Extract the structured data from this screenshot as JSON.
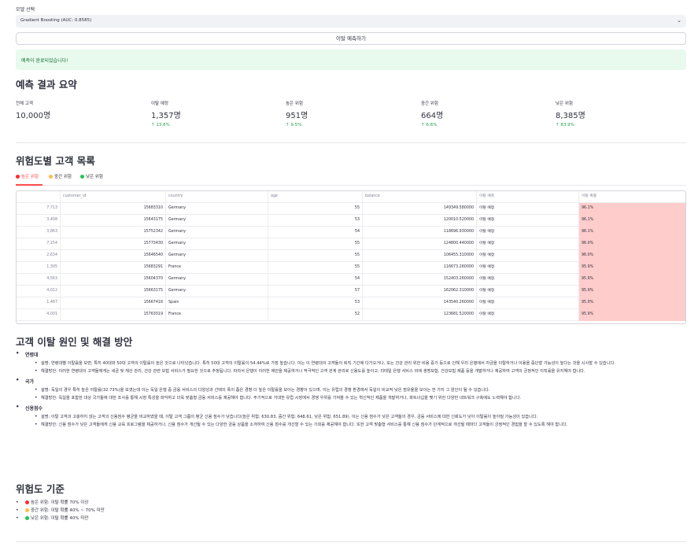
{
  "model_select": {
    "label": "모델 선택",
    "value": "Gradient Boosting (AUC: 0.8585)"
  },
  "predict_button": "이탈 예측하기",
  "success_message": "예측이 완료되었습니다!",
  "summary": {
    "title": "예측 결과 요약",
    "metrics": [
      {
        "label": "전체 고객",
        "value": "10,000명",
        "delta": ""
      },
      {
        "label": "이탈 예정",
        "value": "1,357명",
        "delta": "13.6%"
      },
      {
        "label": "높은 위험",
        "value": "951명",
        "delta": "9.5%"
      },
      {
        "label": "중간 위험",
        "value": "664명",
        "delta": "6.6%"
      },
      {
        "label": "낮은 위험",
        "value": "8,385명",
        "delta": "83.9%"
      }
    ]
  },
  "risk_list": {
    "title": "위험도별 고객 목록",
    "tabs": [
      {
        "label": "높은 위험",
        "color": "#ff2b2b"
      },
      {
        "label": "중간 위험",
        "color": "#ffbd45"
      },
      {
        "label": "낮은 위험",
        "color": "#21c354"
      }
    ],
    "columns": [
      "",
      "customer_id",
      "country",
      "age",
      "balance",
      "이탈 예측",
      "이탈 확률"
    ],
    "rows": [
      [
        "7,713",
        "15683310",
        "Germany",
        "55",
        "149349.580000",
        "이탈 예정",
        "96.1%"
      ],
      [
        "3,408",
        "15643175",
        "Germany",
        "53",
        "120010.520000",
        "이탈 예정",
        "96.1%"
      ],
      [
        "3,863",
        "15752342",
        "Germany",
        "54",
        "118696.930000",
        "이탈 예정",
        "96.1%"
      ],
      [
        "7,154",
        "15773430",
        "Germany",
        "55",
        "124800.440000",
        "이탈 예정",
        "96.0%"
      ],
      [
        "2,634",
        "15646540",
        "Germany",
        "55",
        "106455.310000",
        "이탈 예정",
        "96.0%"
      ],
      [
        "1,305",
        "15683291",
        "France",
        "55",
        "116673.260000",
        "이탈 예정",
        "95.9%"
      ],
      [
        "4,563",
        "15604370",
        "Germany",
        "54",
        "152403.260000",
        "이탈 예정",
        "95.9%"
      ],
      [
        "4,012",
        "15663175",
        "Germany",
        "57",
        "162062.310000",
        "이탈 예정",
        "95.9%"
      ],
      [
        "1,467",
        "15667416",
        "Spain",
        "53",
        "143540.260000",
        "이탈 예정",
        "95.9%"
      ],
      [
        "4,001",
        "15763019",
        "France",
        "52",
        "123681.520000",
        "이탈 예정",
        "95.9%"
      ]
    ]
  },
  "causes": {
    "title": "고객 이탈 원인 및 해결 방안",
    "categories": [
      {
        "name": "연령대",
        "items": [
          "설명: 연령대별 이탈률을 보면, 특히 40대와 50대 고객의 이탈률이 높은 것으로 나타났습니다. 특히 50대 고객의 이탈률이 54.44%로 가장 높습니다. 이는 이 연령대의 고객들이 퇴직 기간에 다가오거나, 또는 건강 관리 위한 비용 증가 등으로 인해 우리 은행에서 자금을 이탈하거나 이용을 중단할 가능성이 높다는 것을 시사할 수 있습니다.",
          "해결방안: 이러한 연령대의 고객들에게는 세금 및 재산 관리, 건강 관련 보험 서비스가 필요한 것으로 추정됩니다. 따라서 은행이 이러한 제안을 제공하거나 적극적인 고객 관계 관리로 신용도를 높이고, 리테일 은행 서비스 외에 생명보험, 건강보험 제품 등을 개발하거나 제공하여 고객의 긍정적인 이직률을 유지해야 합니다."
        ]
      },
      {
        "name": "국가",
        "items": [
          "설명: 독일의 경우 특히 높은 이탈률(32.73%)을 보였는데 이는 독일 은행 중 금융 서비스의 다양성과 선택의 폭이 좁은 경향 더 높은 이탈률을 보이는 경향이 있으며, 이는 유럽의 경쟁 환경에서 독일이 비교적 낮은 점유율을 보이는 한 가지 그 원인이 될 수 있습니다.",
          "해결방안: 독일을 포함한 대상 국가들에 대한 조사를 통해 시장 특성을 파악하고 더욱 맞춤형 금융 서비스를 제공해야 합니다. 주기적으로 거대한 유럽 시장에서 경쟁 우위를 가져올 수 있는 혁신적인 제품을 개발하거나, 파트너십을 맺기 위한 다양한 네트워크 구축에도 노력해야 합니다."
        ]
      },
      {
        "name": "신용점수",
        "items": [
          "설명: 이탈 고객과 고충하지 않는 고객의 신용점수 평균을 비교하였을 때, 이탈 고객 그룹의 평균 신용 점수가 낮습니다(높은 위험: 630.83, 중간 위험: 648.61, 낮은 위험: 651.89). 이는 신용 점수가 낮은 고객들의 경우, 금융 서비스에 대한 신뢰도가 낮아 이탈률이 높아질 가능성이 있습니다.",
          "해결방안: 신용 점수가 낮은 고객들에게 신용 교육 프로그램을 제공하거나, 신용 점수가 개선될 수 있는 다양한 금융 상품을 소개하여 신용 점수를 개선할 수 있는 기회를 제공해야 합니다. 또한 고객 맞춤형 서비스를 통해 신용 점수가 단계적으로 개선될 때마다 고객들이 긍정적인 경험을 할 수 있도록 해야 합니다."
        ]
      }
    ]
  },
  "criteria": {
    "title": "위험도 기준",
    "items": [
      {
        "text": "높은 위험: 이탈 확률 70% 이상",
        "color": "#ff2b2b"
      },
      {
        "text": "중간 위험: 이탈 확률 40% ~ 70% 미만",
        "color": "#ffbd45"
      },
      {
        "text": "낮은 위험: 이탈 확률 40% 미만",
        "color": "#21c354"
      }
    ]
  }
}
